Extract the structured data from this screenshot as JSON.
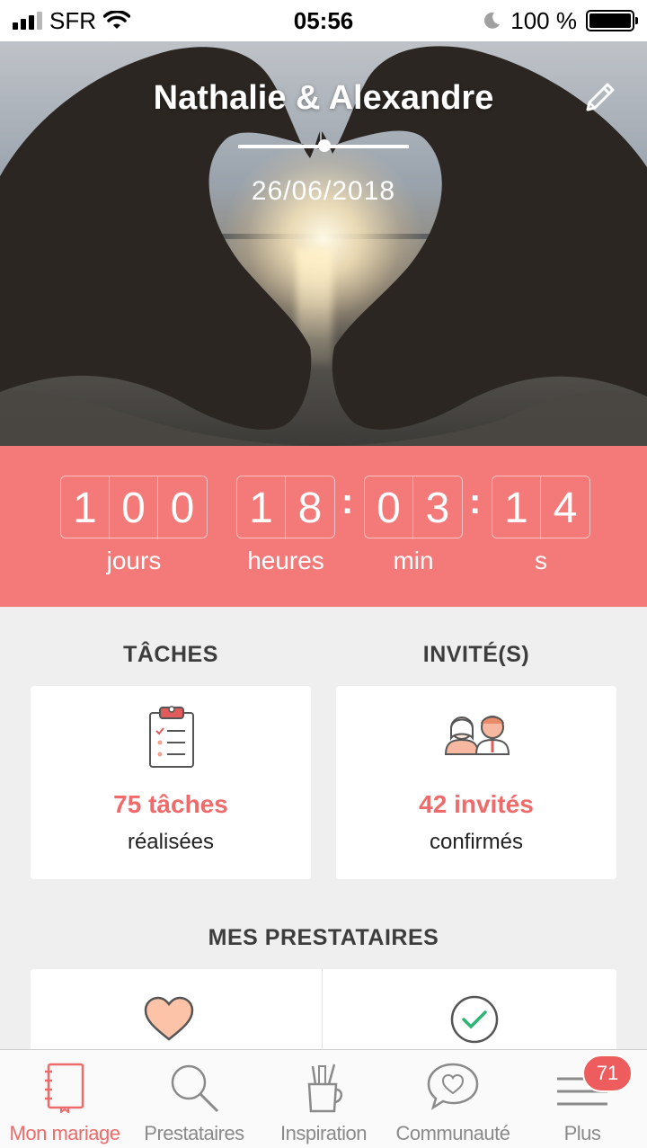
{
  "status_bar": {
    "carrier": "SFR",
    "time": "05:56",
    "battery": "100 %"
  },
  "hero": {
    "couple_names": "Nathalie & Alexandre",
    "wedding_date": "26/06/2018"
  },
  "countdown": {
    "days_digits": [
      "1",
      "0",
      "0"
    ],
    "hours_digits": [
      "1",
      "8"
    ],
    "minutes_digits": [
      "0",
      "3"
    ],
    "seconds_digits": [
      "1",
      "4"
    ],
    "labels": {
      "days": "jours",
      "hours": "heures",
      "minutes": "min",
      "seconds": "s"
    }
  },
  "tasks": {
    "title": "TÂCHES",
    "value": "75 tâches",
    "subtitle": "réalisées"
  },
  "guests": {
    "title": "INVITÉ(S)",
    "value": "42 invités",
    "subtitle": "confirmés"
  },
  "vendors": {
    "title": "MES PRESTATAIRES"
  },
  "tabbar": {
    "tabs": [
      {
        "label": "Mon mariage",
        "icon": "notebook-icon",
        "active": true
      },
      {
        "label": "Prestataires",
        "icon": "search-icon",
        "active": false
      },
      {
        "label": "Inspiration",
        "icon": "pencil-cup-icon",
        "active": false
      },
      {
        "label": "Communauté",
        "icon": "chat-heart-icon",
        "active": false
      },
      {
        "label": "Plus",
        "icon": "menu-icon",
        "active": false
      }
    ],
    "badge_count": "71"
  },
  "colors": {
    "accent": "#f47a7a",
    "accent_text": "#ef6b6b",
    "background": "#efefef"
  }
}
